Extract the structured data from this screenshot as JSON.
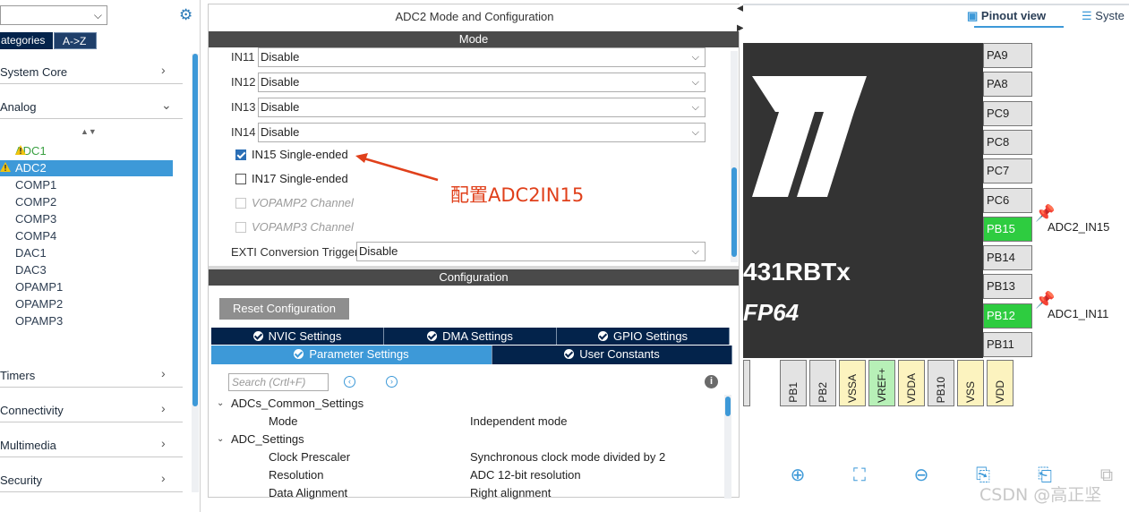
{
  "left": {
    "select_value": "",
    "tab_categories": "ategories",
    "tab_az": "A->Z",
    "categories": [
      {
        "label": "System Core",
        "chev": "›"
      },
      {
        "label": "Analog",
        "chev": "⌄"
      },
      {
        "label": "Timers",
        "chev": "›"
      },
      {
        "label": "Connectivity",
        "chev": "›"
      },
      {
        "label": "Multimedia",
        "chev": "›"
      },
      {
        "label": "Security",
        "chev": "›"
      }
    ],
    "sort_glyph": "▲▼",
    "analog_items": [
      "ADC1",
      "ADC2",
      "COMP1",
      "COMP2",
      "COMP3",
      "COMP4",
      "DAC1",
      "DAC3",
      "OPAMP1",
      "OPAMP2",
      "OPAMP3"
    ],
    "selected_item": "ADC2",
    "warning_items": [
      "ADC1",
      "ADC2"
    ]
  },
  "center": {
    "title": "ADC2 Mode and Configuration",
    "mode_bar": "Mode",
    "inputs": [
      {
        "label": "IN11",
        "value": "Disable"
      },
      {
        "label": "IN12",
        "value": "Disable"
      },
      {
        "label": "IN13",
        "value": "Disable"
      },
      {
        "label": "IN14",
        "value": "Disable"
      }
    ],
    "checkboxes": [
      {
        "label": "IN15 Single-ended",
        "checked": true,
        "disabled": false
      },
      {
        "label": "IN17 Single-ended",
        "checked": false,
        "disabled": false
      },
      {
        "label": "VOPAMP2 Channel",
        "checked": false,
        "disabled": true
      },
      {
        "label": "VOPAMP3 Channel",
        "checked": false,
        "disabled": true
      }
    ],
    "exti_label": "EXTI Conversion Trigger",
    "exti_value": "Disable",
    "annotation": "配置ADC2IN15",
    "config_bar": "Configuration",
    "reset_button": "Reset Configuration",
    "tabs_row1": [
      "NVIC Settings",
      "DMA Settings",
      "GPIO Settings"
    ],
    "tabs_row2": [
      "Parameter Settings",
      "User Constants"
    ],
    "active_tab": "Parameter Settings",
    "search_placeholder": "Search (Crtl+F)",
    "nav_prev": "‹",
    "nav_next": "›",
    "info": "i",
    "params": {
      "group1": "ADCs_Common_Settings",
      "group1_rows": [
        {
          "name": "Mode",
          "value": "Independent mode"
        }
      ],
      "group2": "ADC_Settings",
      "group2_rows": [
        {
          "name": "Clock Prescaler",
          "value": "Synchronous clock mode divided by 2"
        },
        {
          "name": "Resolution",
          "value": "ADC 12-bit resolution"
        },
        {
          "name": "Data Alignment",
          "value": "Right alignment"
        }
      ],
      "expander": "⌄"
    }
  },
  "right": {
    "pinout_view": "Pinout view",
    "system_view": "Syste",
    "chip_name": "431RBTx",
    "chip_pkg": "FP64",
    "right_pins": [
      "PA9",
      "PA8",
      "PC9",
      "PC8",
      "PC7",
      "PC6",
      "PB15",
      "PB14",
      "PB13",
      "PB12",
      "PB11"
    ],
    "green_pins": [
      "PB15",
      "PB12"
    ],
    "pin_labels": [
      {
        "pin": "PB15",
        "label": "ADC2_IN15"
      },
      {
        "pin": "PB12",
        "label": "ADC1_IN11"
      }
    ],
    "bottom_pins": [
      {
        "name": "",
        "color": "grey"
      },
      {
        "name": "PB1",
        "color": "grey"
      },
      {
        "name": "PB2",
        "color": "grey"
      },
      {
        "name": "VSSA",
        "color": "yellow"
      },
      {
        "name": "VREF+",
        "color": "green"
      },
      {
        "name": "VDDA",
        "color": "yellow"
      },
      {
        "name": "PB10",
        "color": "grey"
      },
      {
        "name": "VSS",
        "color": "yellow"
      },
      {
        "name": "VDD",
        "color": "yellow"
      }
    ],
    "watermark": "CSDN @高正坚"
  },
  "colors": {
    "accent": "#3d99d8",
    "navy": "#03234b",
    "pin_green": "#2ecc40",
    "annotation": "#e0401b"
  }
}
